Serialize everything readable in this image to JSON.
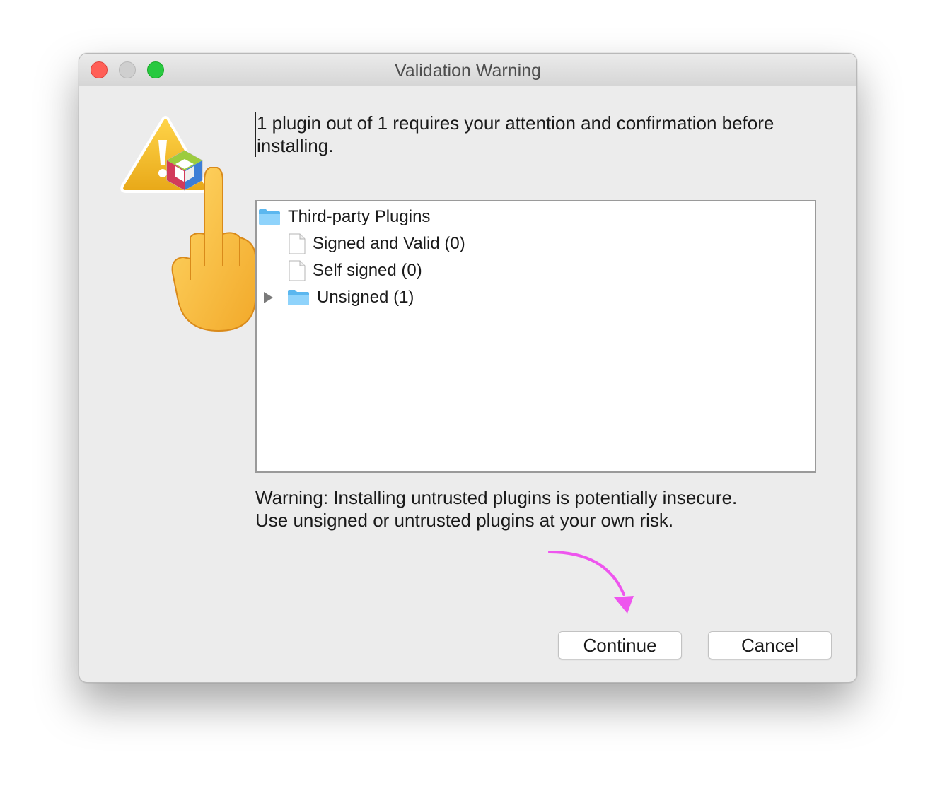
{
  "window": {
    "title": "Validation Warning"
  },
  "message": "1 plugin out of 1 requires your attention and confirmation before installing.",
  "tree": {
    "root": {
      "label": "Third-party Plugins",
      "icon": "folder-icon"
    },
    "children": [
      {
        "label": "Signed and Valid (0)",
        "icon": "file-icon"
      },
      {
        "label": "Self signed (0)",
        "icon": "file-icon"
      },
      {
        "label": "Unsigned (1)",
        "icon": "folder-icon",
        "expandable": true
      }
    ]
  },
  "warning": {
    "line1": "Warning: Installing untrusted plugins is potentially insecure.",
    "line2": "Use unsigned or untrusted plugins at your own risk."
  },
  "buttons": {
    "continue": "Continue",
    "cancel": "Cancel"
  },
  "colors": {
    "close": "#ff5f57",
    "minimize": "#cfcfcf",
    "zoom": "#28c940",
    "annotation_arrow": "#ee55ee",
    "folder": "#6cc4f4"
  }
}
